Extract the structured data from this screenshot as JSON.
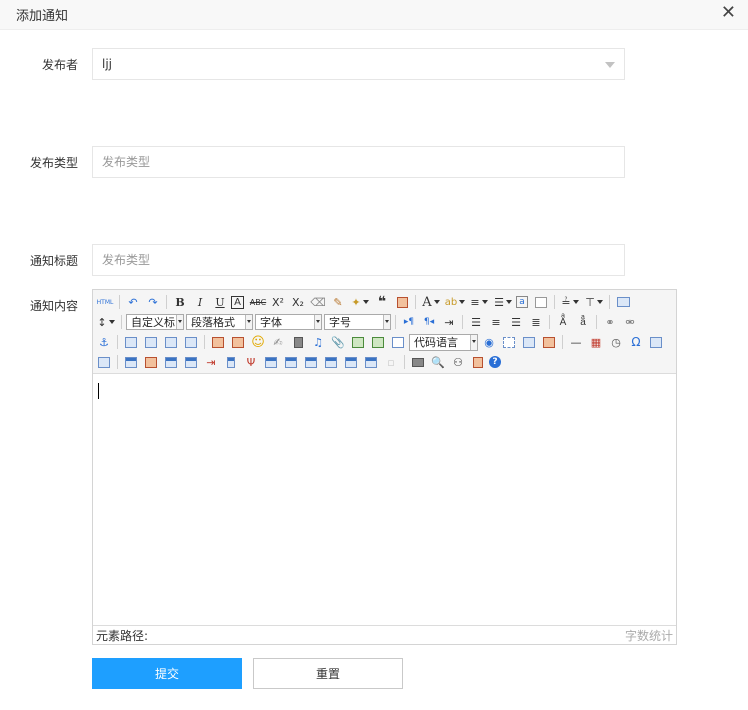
{
  "dialog": {
    "title": "添加通知",
    "close_glyph": "✕"
  },
  "form": {
    "publisher": {
      "label": "发布者",
      "value": "ljj"
    },
    "publish_type": {
      "label": "发布类型",
      "placeholder": "发布类型"
    },
    "notice_title": {
      "label": "通知标题",
      "placeholder": "发布类型"
    },
    "notice_content": {
      "label": "通知内容"
    }
  },
  "editor": {
    "toolbar": {
      "html_label": "HTML",
      "custom_title": "自定义标",
      "paragraph_format": "段落格式",
      "font_family": "字体",
      "font_size": "字号",
      "code_language": "代码语言"
    },
    "status": {
      "element_path": "元素路径:",
      "word_count": "字数统计"
    }
  },
  "buttons": {
    "submit": "提交",
    "reset": "重置"
  },
  "colors": {
    "primary": "#1e9fff",
    "border": "#e6e6e6",
    "placeholder": "#999999"
  }
}
